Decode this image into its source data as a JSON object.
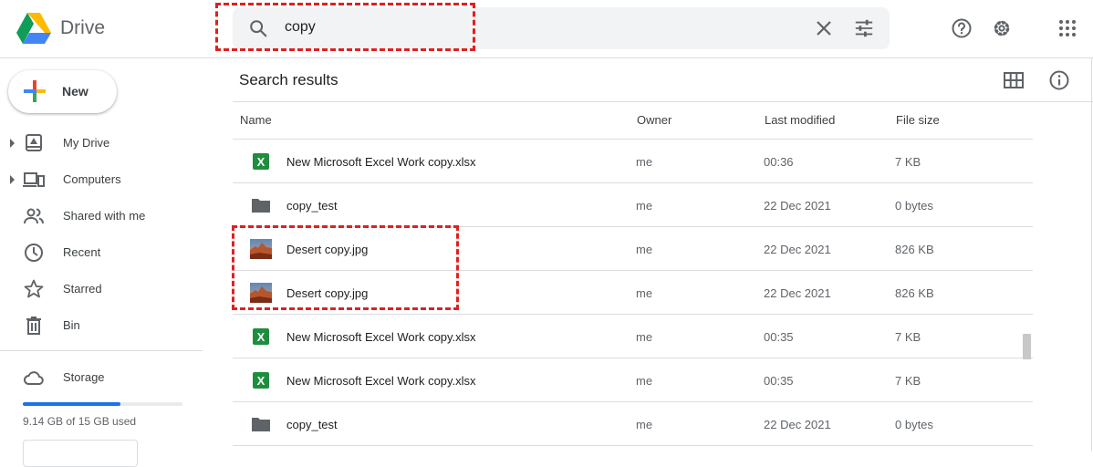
{
  "app": {
    "name": "Drive"
  },
  "search": {
    "query": "copy"
  },
  "sidebar": {
    "new_label": "New",
    "items": [
      {
        "label": "My Drive",
        "icon": "my-drive-icon",
        "expandable": true
      },
      {
        "label": "Computers",
        "icon": "computers-icon",
        "expandable": true
      },
      {
        "label": "Shared with me",
        "icon": "shared-icon",
        "expandable": false
      },
      {
        "label": "Recent",
        "icon": "clock-icon",
        "expandable": false
      },
      {
        "label": "Starred",
        "icon": "star-icon",
        "expandable": false
      },
      {
        "label": "Bin",
        "icon": "trash-icon",
        "expandable": false
      }
    ],
    "storage": {
      "label": "Storage",
      "usage_text": "9.14 GB of 15 GB used",
      "used_fraction": 0.61
    }
  },
  "main": {
    "title": "Search results",
    "columns": {
      "name": "Name",
      "owner": "Owner",
      "modified": "Last modified",
      "size": "File size"
    },
    "rows": [
      {
        "type": "excel",
        "name": "New Microsoft Excel Work copy.xlsx",
        "owner": "me",
        "modified": "00:36",
        "size": "7 KB"
      },
      {
        "type": "folder",
        "name": "copy_test",
        "owner": "me",
        "modified": "22 Dec 2021",
        "size": "0 bytes"
      },
      {
        "type": "image",
        "name": "Desert copy.jpg",
        "owner": "me",
        "modified": "22 Dec 2021",
        "size": "826 KB"
      },
      {
        "type": "image",
        "name": "Desert copy.jpg",
        "owner": "me",
        "modified": "22 Dec 2021",
        "size": "826 KB"
      },
      {
        "type": "excel",
        "name": "New Microsoft Excel Work copy.xlsx",
        "owner": "me",
        "modified": "00:35",
        "size": "7 KB"
      },
      {
        "type": "excel",
        "name": "New Microsoft Excel Work copy.xlsx",
        "owner": "me",
        "modified": "00:35",
        "size": "7 KB"
      },
      {
        "type": "folder",
        "name": "copy_test",
        "owner": "me",
        "modified": "22 Dec 2021",
        "size": "0 bytes"
      }
    ]
  },
  "colors": {
    "highlight": "#e02020",
    "accent": "#1a73e8",
    "excel": "#1e8e3e",
    "folder": "#5f6368"
  }
}
